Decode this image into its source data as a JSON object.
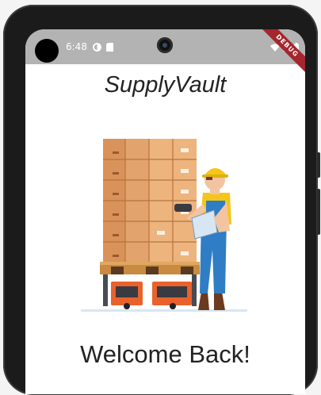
{
  "status_bar": {
    "time": "6:48",
    "left_icons": [
      "circle-status-icon",
      "sim-card-icon"
    ],
    "right_icons": [
      "wifi-icon",
      "signal-icon",
      "battery-icon"
    ],
    "debug_banner": "DEBUG"
  },
  "app": {
    "title": "SupplyVault",
    "illustration": "warehouse-worker-with-pallet-icon",
    "welcome_text": "Welcome Back!"
  },
  "colors": {
    "status_bar_bg": "#b3b3b3",
    "debug_banner": "#a3272d",
    "boxes": "#d9925a",
    "worker_overalls": "#2f7dc4",
    "worker_helmet": "#f5c518"
  }
}
